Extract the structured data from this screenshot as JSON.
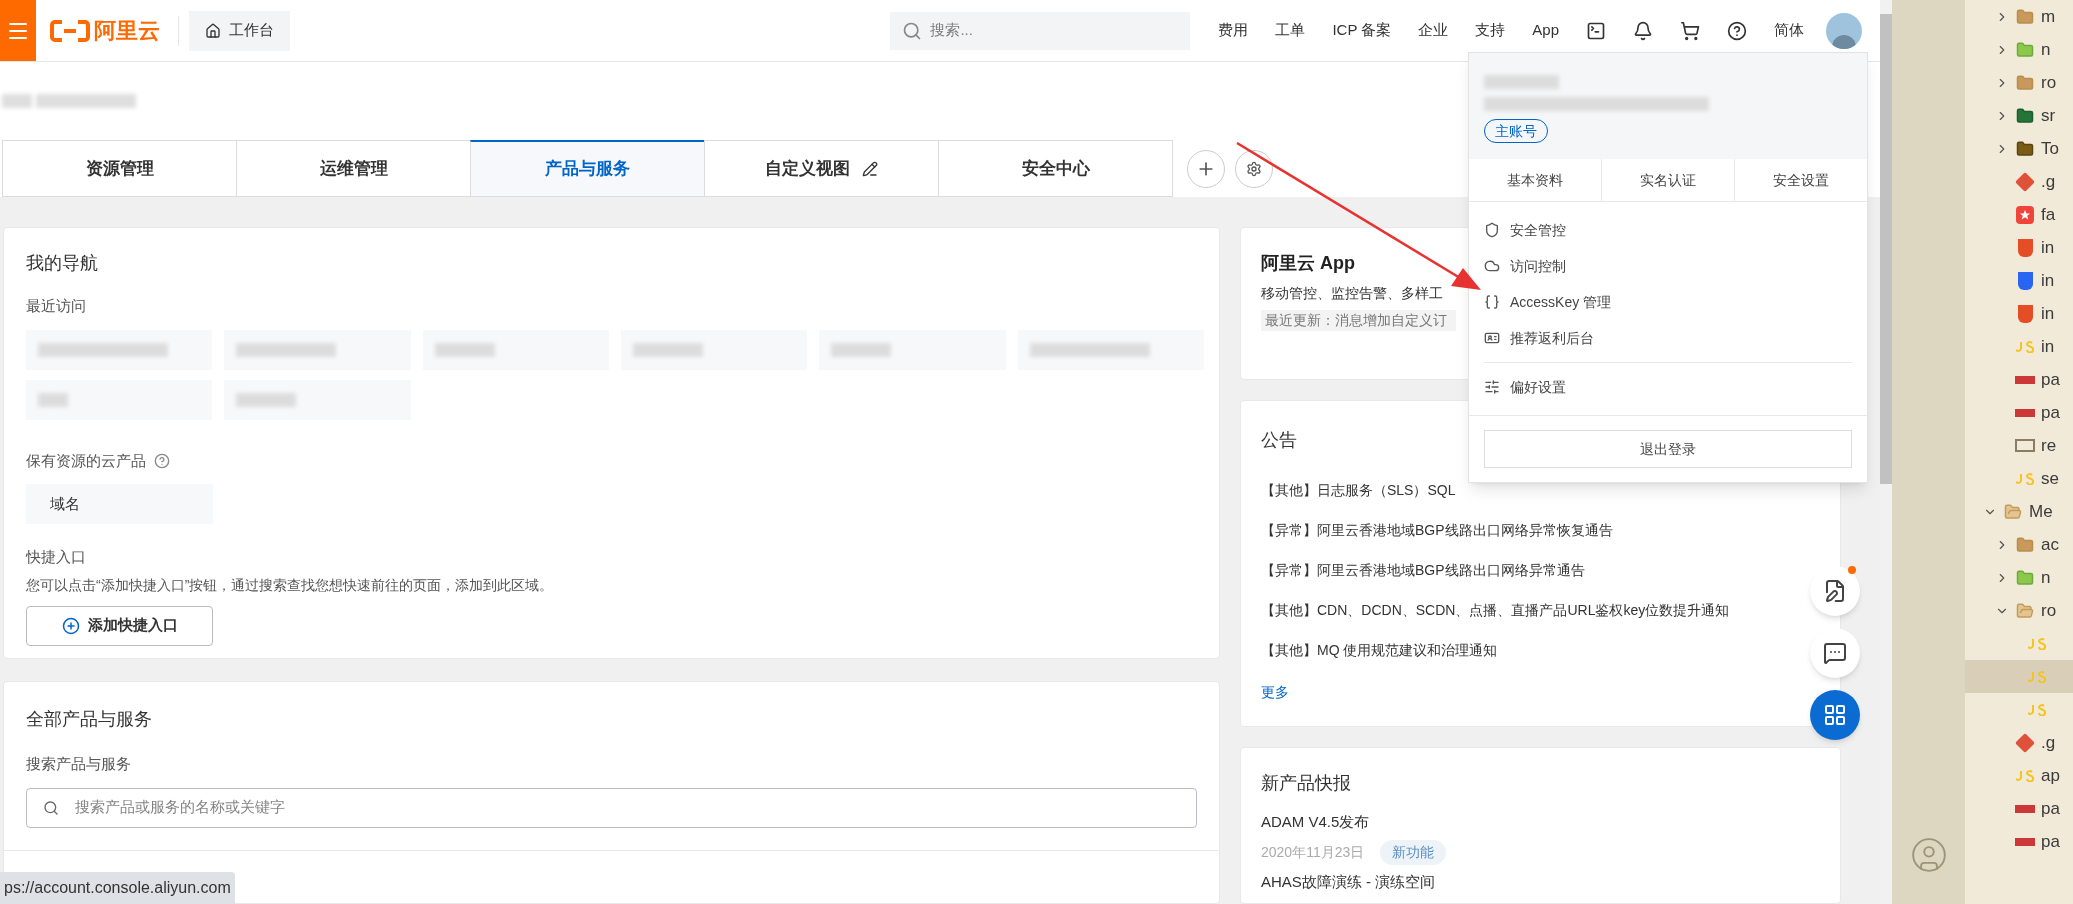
{
  "header": {
    "logo": "阿里云",
    "workbench": "工作台",
    "search": {
      "placeholder": "搜索..."
    },
    "links": [
      "费用",
      "工单",
      "ICP 备案",
      "企业",
      "支持",
      "App"
    ],
    "language": "简体"
  },
  "tabs": [
    {
      "label": "资源管理",
      "selected": false,
      "editable": false
    },
    {
      "label": "运维管理",
      "selected": false,
      "editable": false
    },
    {
      "label": "产品与服务",
      "selected": true,
      "editable": false
    },
    {
      "label": "自定义视图",
      "selected": false,
      "editable": true
    },
    {
      "label": "安全中心",
      "selected": false,
      "editable": false
    }
  ],
  "my_nav": {
    "title": "我的导航",
    "recent_label": "最近访问",
    "recent_visits": [
      {
        "kind": "redacted"
      },
      {
        "kind": "redacted"
      },
      {
        "kind": "redacted"
      },
      {
        "kind": "redacted"
      },
      {
        "kind": "redacted"
      },
      {
        "kind": "redacted"
      },
      {
        "kind": "redacted"
      },
      {
        "kind": "redacted"
      }
    ],
    "resources": {
      "label": "保有资源的云产品",
      "items": [
        "域名"
      ]
    },
    "shortcuts": {
      "label": "快捷入口",
      "description": "您可以点击“添加快捷入口”按钮，通过搜索查找您想快速前往的页面，添加到此区域。",
      "button": "添加快捷入口"
    }
  },
  "all_products": {
    "title": "全部产品与服务",
    "search_label": "搜索产品与服务",
    "search": {
      "placeholder": "搜索产品或服务的名称或关键字"
    }
  },
  "app_card": {
    "title": "阿里云 App",
    "description": "移动管控、监控告警、多样工",
    "update": "最近更新：消息增加自定义订"
  },
  "notices": {
    "title": "公告",
    "items": [
      "【其他】日志服务（SLS）SQL",
      "【异常】阿里云香港地域BGP线路出口网络异常恢复通告",
      "【异常】阿里云香港地域BGP线路出口网络异常通告",
      "【其他】CDN、DCDN、SCDN、点播、直播产品URL鉴权key位数提升通知",
      "【其他】MQ 使用规范建议和治理通知"
    ],
    "more": "更多"
  },
  "new_products": {
    "title": "新产品快报",
    "items": [
      {
        "title": "ADAM V4.5发布",
        "date": "2020年11月23日",
        "tag": "新功能"
      },
      {
        "title": "AHAS故障演练 - 演练空间"
      }
    ]
  },
  "account_menu": {
    "badge": "主账号",
    "tabs": [
      "基本资料",
      "实名认证",
      "安全设置"
    ],
    "items": [
      {
        "kind": "shield",
        "label": "安全管控"
      },
      {
        "kind": "cloud",
        "label": "访问控制"
      },
      {
        "kind": "key",
        "label": "AccessKey 管理"
      },
      {
        "kind": "card",
        "label": "推荐返利后台"
      }
    ],
    "settings_items": [
      {
        "kind": "sliders",
        "label": "偏好设置"
      }
    ],
    "logout": "退出登录"
  },
  "float_buttons": [
    {
      "kind": "feedback",
      "notification": true
    },
    {
      "kind": "chat",
      "notification": false
    },
    {
      "kind": "apps",
      "notification": false
    }
  ],
  "status_url": "ps://account.console.aliyun.com",
  "explorer": {
    "continued_items": [
      {
        "kind": "folder",
        "label": "m",
        "expanded": false
      },
      {
        "kind": "node",
        "label": "n",
        "expanded": false
      },
      {
        "kind": "folder",
        "label": "ro",
        "expanded": false
      },
      {
        "kind": "src",
        "label": "sr",
        "expanded": false
      },
      {
        "kind": "tools",
        "label": "To",
        "expanded": false
      },
      {
        "kind": "git",
        "label": ".g"
      },
      {
        "kind": "star",
        "label": "fa"
      },
      {
        "kind": "html",
        "label": "in"
      },
      {
        "kind": "css",
        "label": "in"
      },
      {
        "kind": "html",
        "label": "in"
      },
      {
        "kind": "js",
        "label": "in"
      },
      {
        "kind": "npm",
        "label": "pa"
      },
      {
        "kind": "npm",
        "label": "pa"
      },
      {
        "kind": "md",
        "label": "re"
      },
      {
        "kind": "js",
        "label": "se"
      }
    ],
    "items": [
      {
        "kind": "folder",
        "label": "Me",
        "expanded": true,
        "children": [
          {
            "kind": "folder",
            "label": "ac",
            "expanded": false
          },
          {
            "kind": "node",
            "label": "n",
            "expanded": false
          },
          {
            "kind": "folder",
            "label": "ro",
            "expanded": true,
            "children": [
              {
                "kind": "js",
                "selected": false
              },
              {
                "kind": "js",
                "selected": true
              },
              {
                "kind": "js",
                "selected": false
              }
            ]
          },
          {
            "kind": "git",
            "label": ".g"
          },
          {
            "kind": "js",
            "label": "ap"
          },
          {
            "kind": "npm",
            "label": "pa"
          },
          {
            "kind": "npm",
            "label": "pa"
          }
        ]
      }
    ]
  }
}
